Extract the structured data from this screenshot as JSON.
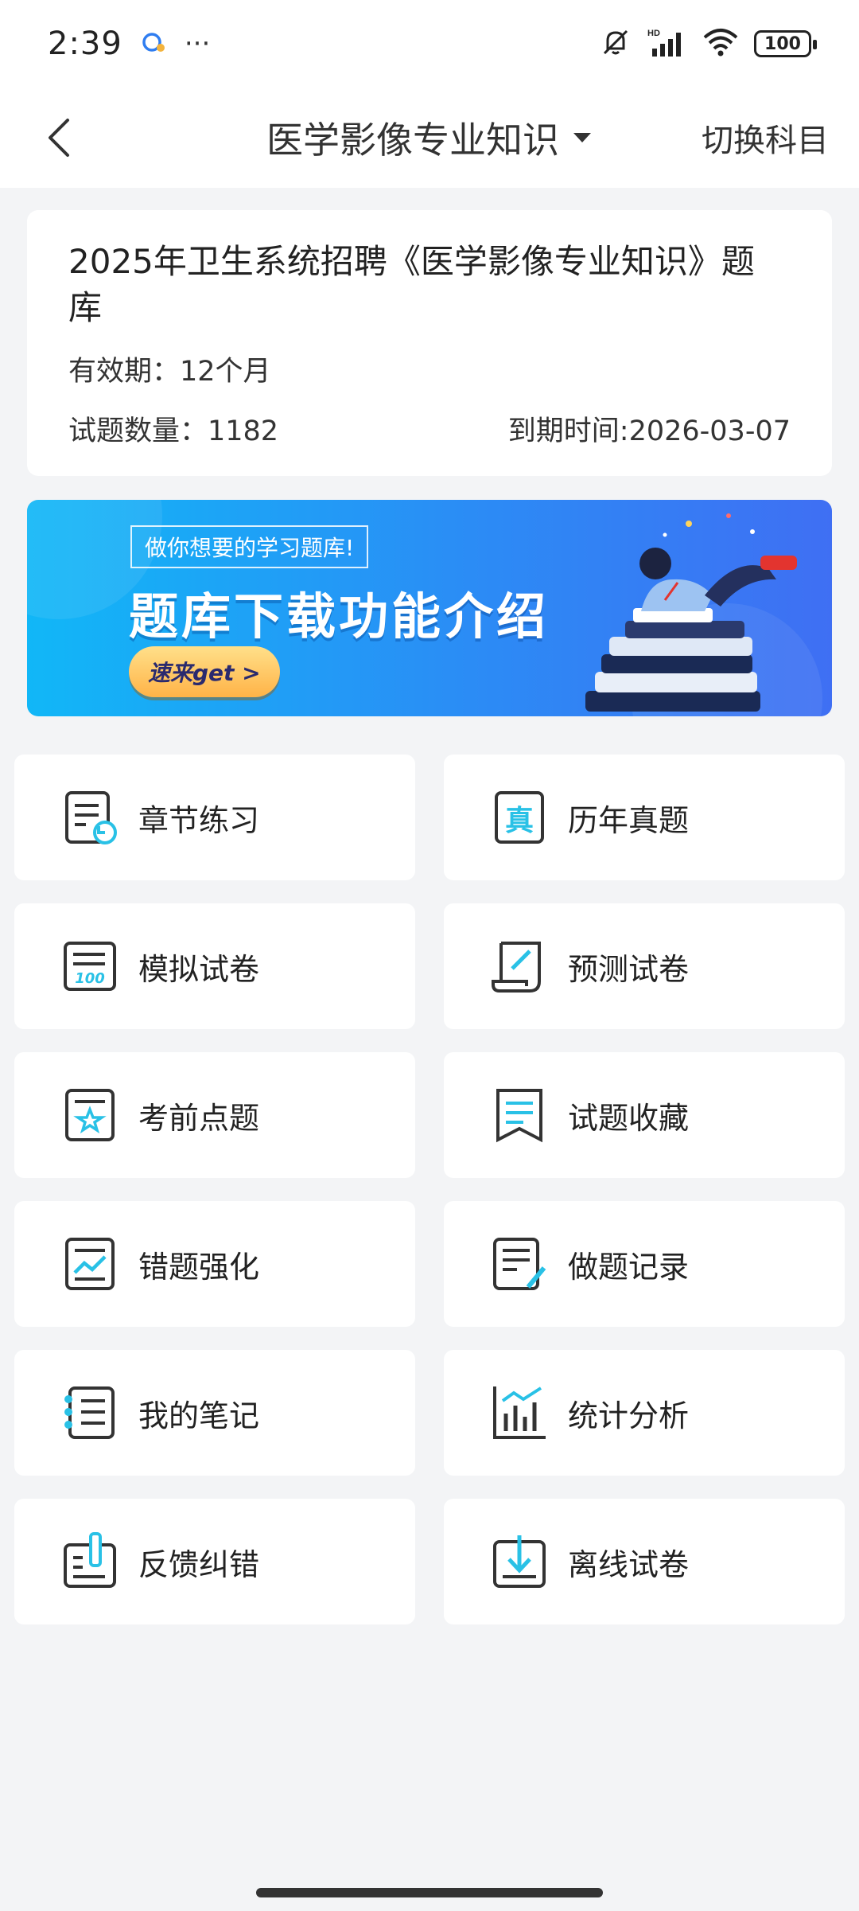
{
  "status_bar": {
    "time": "2:39",
    "dots": "···",
    "battery": "100"
  },
  "nav": {
    "title": "医学影像专业知识",
    "switch_label": "切换科目"
  },
  "info_card": {
    "title": "2025年卫生系统招聘《医学影像专业知识》题库",
    "validity": "有效期：12个月",
    "question_count": "试题数量：1182",
    "expiry": "到期时间:2026-03-07"
  },
  "banner": {
    "tag": "做你想要的学习题库!",
    "headline": "题库下载功能介绍",
    "cta": "速来get >"
  },
  "menu": {
    "items": [
      {
        "label": "章节练习",
        "icon": "chapter-practice-icon"
      },
      {
        "label": "历年真题",
        "icon": "past-exam-icon"
      },
      {
        "label": "模拟试卷",
        "icon": "mock-paper-icon"
      },
      {
        "label": "预测试卷",
        "icon": "predict-paper-icon"
      },
      {
        "label": "考前点题",
        "icon": "pre-exam-tips-icon"
      },
      {
        "label": "试题收藏",
        "icon": "favorites-icon"
      },
      {
        "label": "错题强化",
        "icon": "wrong-question-icon"
      },
      {
        "label": "做题记录",
        "icon": "practice-record-icon"
      },
      {
        "label": "我的笔记",
        "icon": "notes-icon"
      },
      {
        "label": "统计分析",
        "icon": "statistics-icon"
      },
      {
        "label": "反馈纠错",
        "icon": "feedback-icon"
      },
      {
        "label": "离线试卷",
        "icon": "offline-paper-icon"
      }
    ]
  },
  "colors": {
    "accent": "#29c1e6",
    "icon_stroke": "#333333",
    "background": "#f3f4f6"
  }
}
